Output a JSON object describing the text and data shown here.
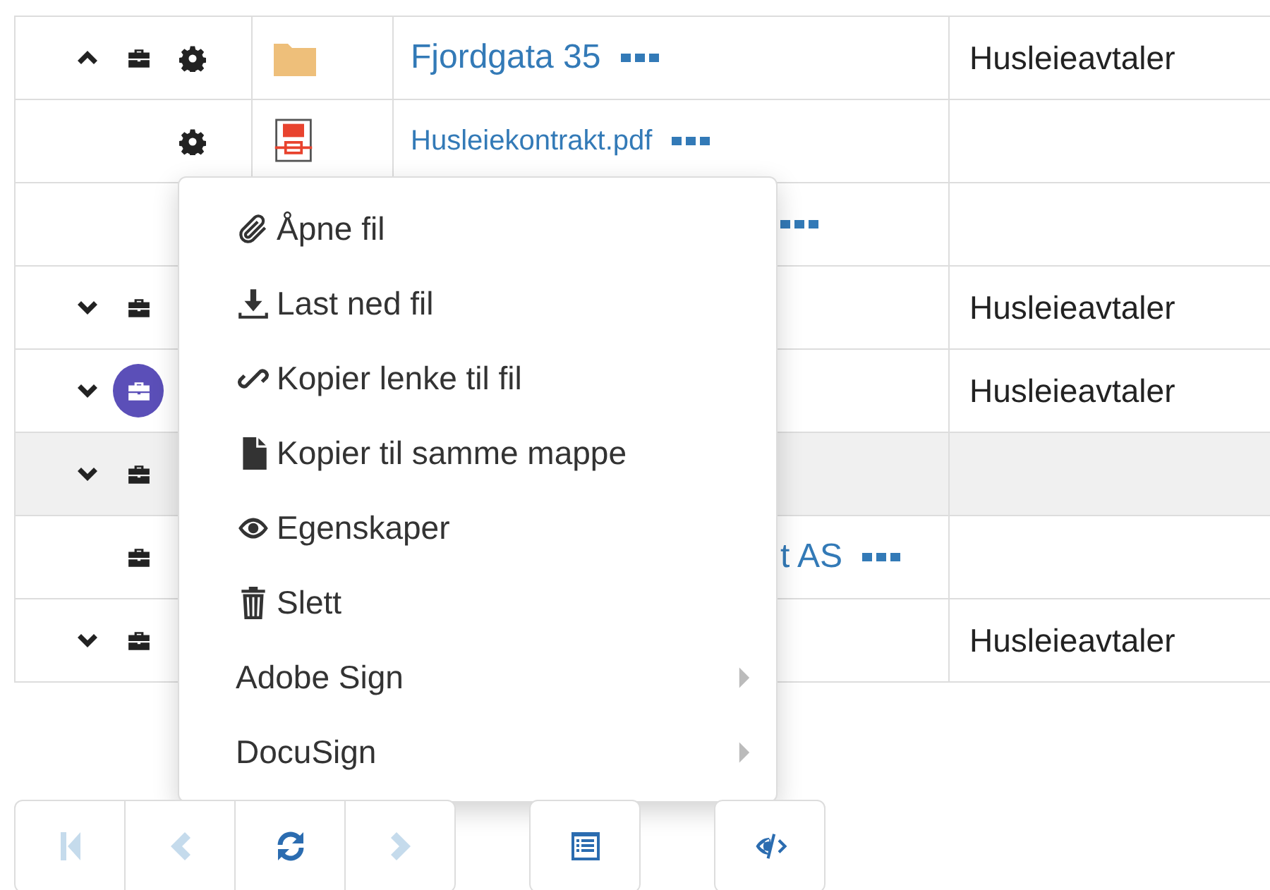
{
  "rows": [
    {
      "expanded": true,
      "briefcase": true,
      "highlighted": false,
      "gear": true,
      "file": {
        "kind": "folder"
      },
      "name": "Fjordgata 35",
      "more": true,
      "category": "Husleieavtaler",
      "selected": false
    },
    {
      "briefcase": false,
      "gear": true,
      "file": {
        "kind": "pdf"
      },
      "name": "Husleiekontrakt.pdf",
      "more": true,
      "selected": false
    },
    {
      "briefcase": false,
      "gear": false,
      "more": true,
      "selected": false
    },
    {
      "expanded": false,
      "briefcase": true,
      "highlighted": false,
      "gear": false,
      "more": false,
      "category": "Husleieavtaler",
      "selected": false
    },
    {
      "expanded": false,
      "briefcase": true,
      "highlighted": true,
      "gear": false,
      "more": false,
      "category": "Husleieavtaler",
      "selected": false
    },
    {
      "expanded": false,
      "briefcase": true,
      "highlighted": false,
      "gear": false,
      "more": false,
      "selected": true
    },
    {
      "briefcase": true,
      "highlighted": false,
      "gear": false,
      "name": "t AS",
      "more": true,
      "selected": false
    },
    {
      "expanded": false,
      "briefcase": true,
      "highlighted": false,
      "gear": false,
      "more": false,
      "category": "Husleieavtaler",
      "selected": false
    }
  ],
  "menu": [
    {
      "kind": "action",
      "label": "Åpne fil"
    },
    {
      "kind": "action",
      "label": "Last ned fil"
    },
    {
      "kind": "action",
      "label": "Kopier lenke til fil"
    },
    {
      "kind": "action",
      "label": "Kopier til samme mappe"
    },
    {
      "kind": "action",
      "label": "Egenskaper"
    },
    {
      "kind": "action",
      "label": "Slett"
    },
    {
      "kind": "submenu",
      "label": "Adobe Sign"
    },
    {
      "kind": "submenu",
      "label": "DocuSign"
    }
  ],
  "pager": [
    {
      "kind": "nav",
      "disabled": true
    },
    {
      "kind": "nav",
      "disabled": true
    },
    {
      "kind": "nav",
      "disabled": false
    },
    {
      "kind": "nav",
      "disabled": true
    },
    {
      "kind": "list",
      "disabled": false
    },
    {
      "kind": "view",
      "disabled": false
    }
  ]
}
